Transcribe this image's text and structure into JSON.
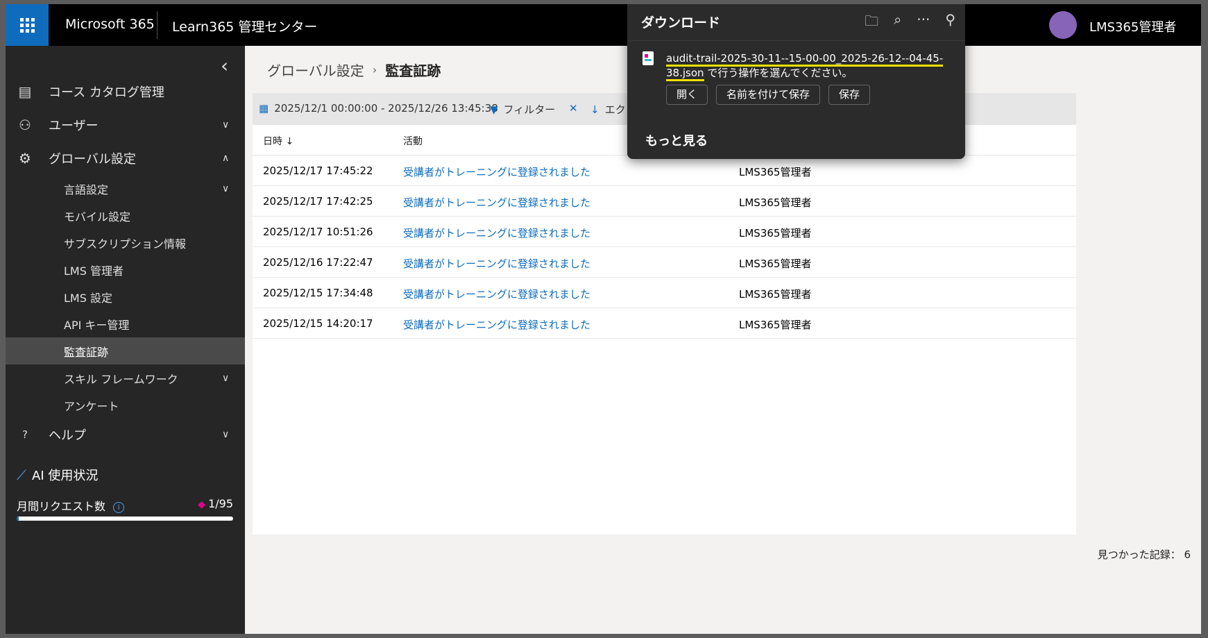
{
  "header": {
    "brand": "Microsoft 365",
    "app_name": "Learn365 管理センター",
    "user_name": "LMS365管理者"
  },
  "sidebar": {
    "items": [
      {
        "label": "コース カタログ管理",
        "icon": "catalog-icon"
      },
      {
        "label": "ユーザー",
        "icon": "users-icon"
      },
      {
        "label": "グローバル設定",
        "icon": "gear-icon"
      }
    ],
    "sub_items": [
      {
        "label": "言語設定"
      },
      {
        "label": "モバイル設定"
      },
      {
        "label": "サブスクリプション情報"
      },
      {
        "label": "LMS 管理者"
      },
      {
        "label": "LMS 設定"
      },
      {
        "label": "API キー管理"
      },
      {
        "label": "監査証跡"
      },
      {
        "label": "スキル フレームワーク"
      },
      {
        "label": "アンケート"
      }
    ],
    "help": "ヘルプ",
    "ai_usage": {
      "title": "AI 使用状況",
      "monthly_label": "月間リクエスト数",
      "count": "1/95",
      "used": 1,
      "limit": 95
    }
  },
  "breadcrumb": {
    "parent": "グローバル設定",
    "current": "監査証跡"
  },
  "toolbar": {
    "date_range": "2025/12/1 00:00:00 - 2025/12/26 13:45:38",
    "filter": "フィルター",
    "export": "エク"
  },
  "table": {
    "headers": {
      "datetime": "日時",
      "activity": "活動"
    },
    "rows": [
      {
        "datetime": "2025/12/17 17:45:22",
        "activity": "受講者がトレーニングに登録されました",
        "user": "LMS365管理者"
      },
      {
        "datetime": "2025/12/17 17:42:25",
        "activity": "受講者がトレーニングに登録されました",
        "user": "LMS365管理者"
      },
      {
        "datetime": "2025/12/17 10:51:26",
        "activity": "受講者がトレーニングに登録されました",
        "user": "LMS365管理者"
      },
      {
        "datetime": "2025/12/16 17:22:47",
        "activity": "受講者がトレーニングに登録されました",
        "user": "LMS365管理者"
      },
      {
        "datetime": "2025/12/15 17:34:48",
        "activity": "受講者がトレーニングに登録されました",
        "user": "LMS365管理者"
      },
      {
        "datetime": "2025/12/15 14:20:17",
        "activity": "受講者がトレーニングに登録されました",
        "user": "LMS365管理者"
      }
    ]
  },
  "footer": {
    "records_found": "見つかった記録： 6"
  },
  "download_panel": {
    "title": "ダウンロード",
    "filename": "audit-trail-2025-30-11--15-00-00_2025-26-12--04-45-38.json",
    "prompt": " で行う操作を選んでください。",
    "buttons": {
      "open": "開く",
      "save_as": "名前を付けて保存",
      "save": "保存"
    },
    "more": "もっと見る"
  },
  "colors": {
    "accent": "#0f6cbd",
    "highlight": "#f2e200",
    "sidebar_bg": "#262626",
    "topbar_bg": "#000000"
  }
}
